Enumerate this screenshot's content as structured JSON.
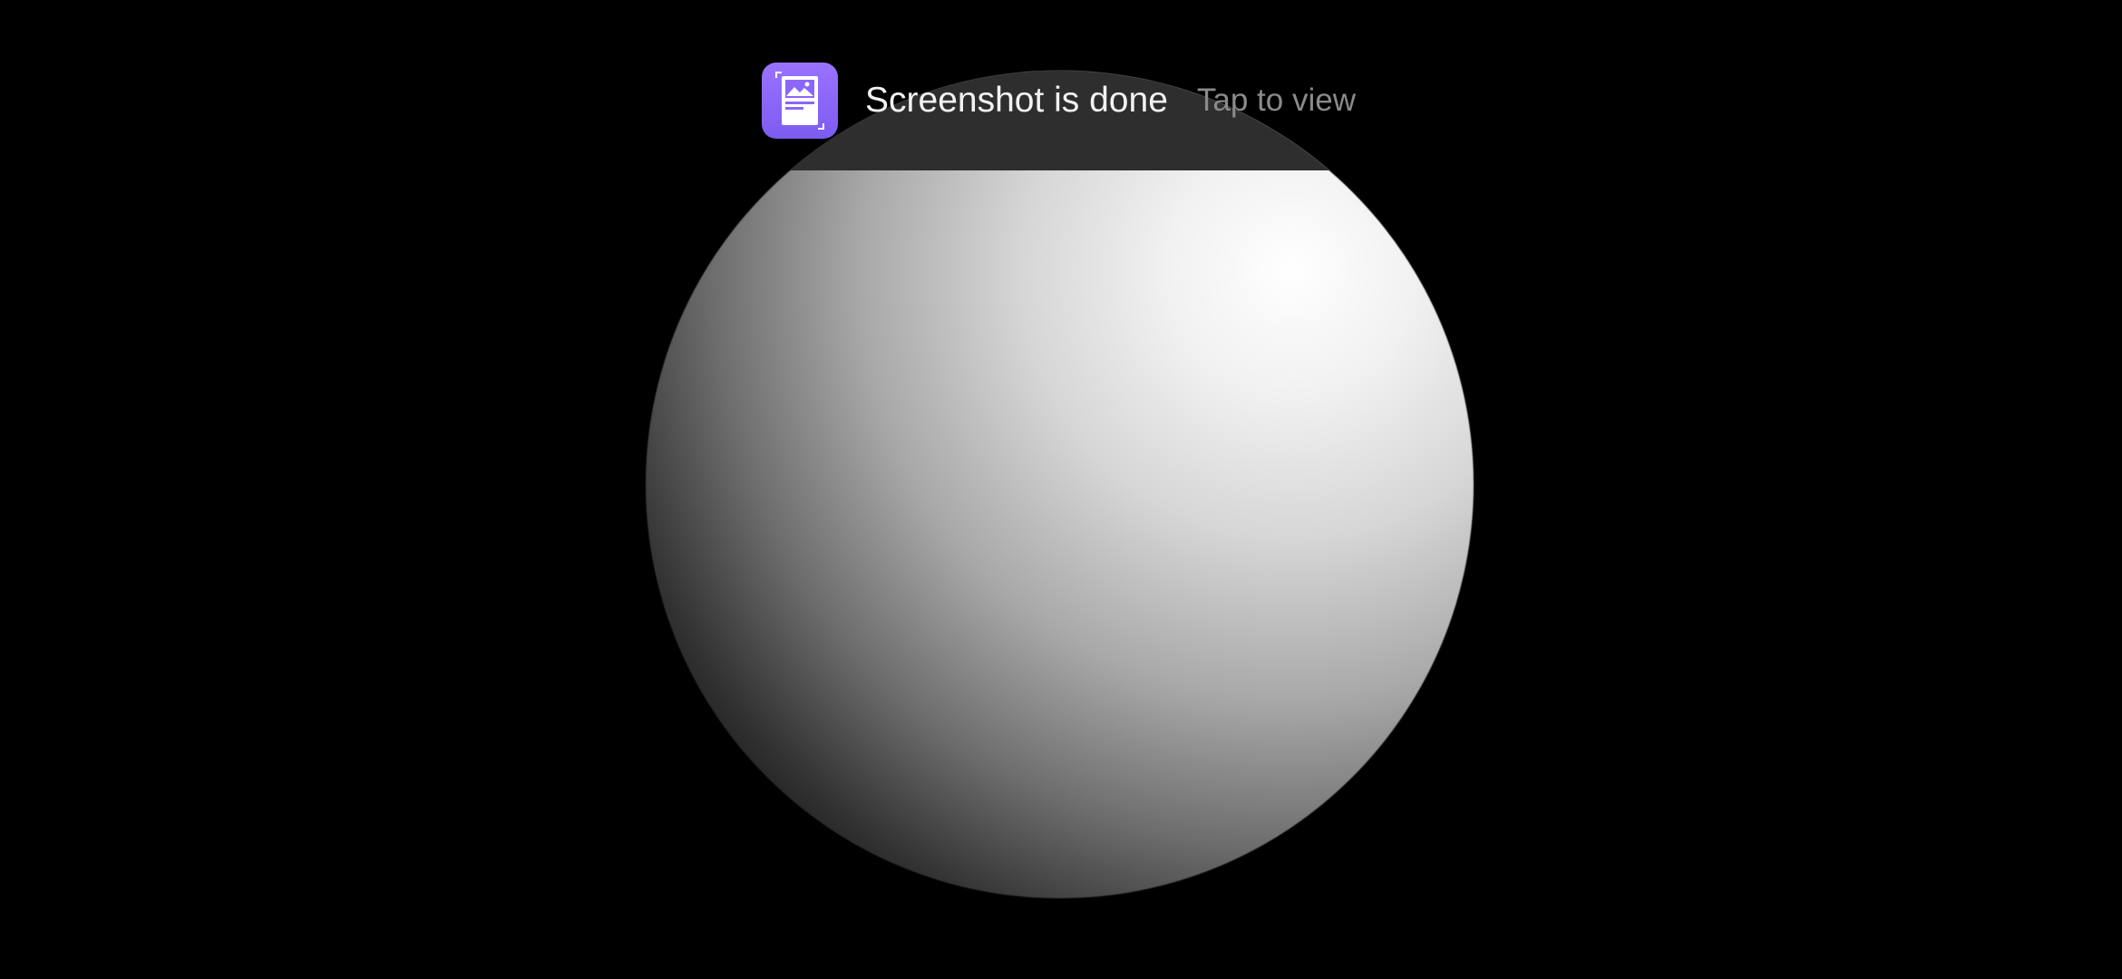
{
  "toast": {
    "icon": "screenshot-icon",
    "title": "Screenshot is done",
    "action": "Tap to view",
    "icon_color": "#8b66f8"
  },
  "scene": {
    "object": "sphere",
    "background_color": "#000000"
  }
}
